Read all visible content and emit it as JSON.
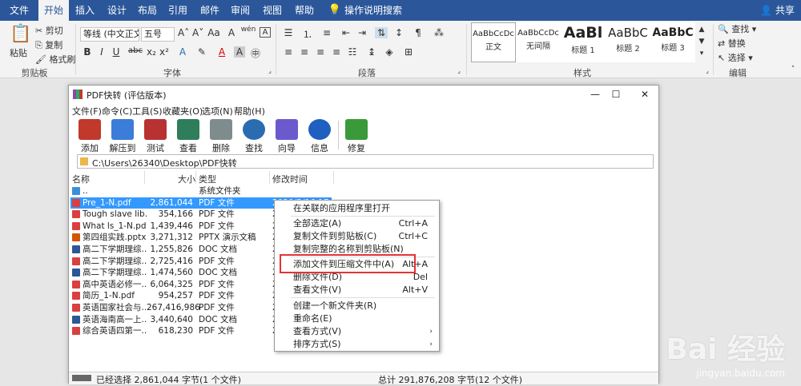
{
  "word": {
    "tabs": [
      "文件",
      "开始",
      "插入",
      "设计",
      "布局",
      "引用",
      "邮件",
      "审阅",
      "视图",
      "帮助"
    ],
    "search_hint": "操作说明搜索",
    "share": "共享",
    "clipboard": {
      "paste": "粘贴",
      "cut": "剪切",
      "copy": "复制",
      "format_painter": "格式刷",
      "label": "剪贴板"
    },
    "font": {
      "family": "等线 (中文正文)",
      "size": "五号",
      "label": "字体",
      "bold": "B",
      "italic": "I",
      "underline": "U",
      "wen": "wén"
    },
    "paragraph": {
      "label": "段落"
    },
    "styles": {
      "label": "样式",
      "items": [
        {
          "preview": "AaBbCcDc",
          "name": "正文"
        },
        {
          "preview": "AaBbCcDc",
          "name": "无间隔"
        },
        {
          "preview": "AaBl",
          "name": "标题 1"
        },
        {
          "preview": "AaBbC",
          "name": "标题 2"
        },
        {
          "preview": "AaBbC",
          "name": "标题 3"
        }
      ]
    },
    "editing": {
      "label": "编辑",
      "find": "查找",
      "replace": "替换",
      "select": "选择"
    }
  },
  "winrar": {
    "title": "PDF快转 (评估版本)",
    "menu": [
      "文件(F)",
      "命令(C)",
      "工具(S)",
      "收藏夹(O)",
      "选项(N)",
      "帮助(H)"
    ],
    "toolbar": [
      {
        "label": "添加",
        "color": "#c0392b"
      },
      {
        "label": "解压到",
        "color": "#3b7dd8"
      },
      {
        "label": "测试",
        "color": "#b83232"
      },
      {
        "label": "查看",
        "color": "#2e7d5b"
      },
      {
        "label": "删除",
        "color": "#7f8c8d"
      },
      {
        "label": "查找",
        "color": "#2b6cb0"
      },
      {
        "label": "向导",
        "color": "#6a5acd"
      },
      {
        "label": "信息",
        "color": "#1f5fbf"
      },
      {
        "label": "修复",
        "color": "#3a9a3a"
      }
    ],
    "address": "C:\\Users\\26340\\Desktop\\PDF快转",
    "columns": [
      "名称",
      "大小",
      "类型",
      "修改时间"
    ],
    "rows": [
      {
        "name": "..",
        "size": "",
        "type": "系统文件夹",
        "time": "",
        "icon": "#3b8fd8"
      },
      {
        "name": "Pre_1-N.pdf",
        "size": "2,861,044",
        "type": "PDF 文件",
        "time": "2020/3/16 17:...",
        "icon": "#d94040"
      },
      {
        "name": "Tough slave lib...",
        "size": "354,166",
        "type": "PDF 文件",
        "time": "2",
        "icon": "#d94040"
      },
      {
        "name": "What ls_1-N.pdf",
        "size": "1,439,446",
        "type": "PDF 文件",
        "time": "2",
        "icon": "#d94040"
      },
      {
        "name": "第四组实践.pptx",
        "size": "3,271,312",
        "type": "PPTX 演示文稿",
        "time": "2",
        "icon": "#d35400"
      },
      {
        "name": "高二下学期理综...",
        "size": "1,255,826",
        "type": "DOC 文档",
        "time": "2",
        "icon": "#2b5797"
      },
      {
        "name": "高二下学期理综...",
        "size": "2,725,416",
        "type": "PDF 文件",
        "time": "2",
        "icon": "#d94040"
      },
      {
        "name": "高二下学期理综...",
        "size": "1,474,560",
        "type": "DOC 文档",
        "time": "2",
        "icon": "#2b5797"
      },
      {
        "name": "高中英语必修一...",
        "size": "6,064,325",
        "type": "PDF 文件",
        "time": "2",
        "icon": "#d94040"
      },
      {
        "name": "简历_1-N.pdf",
        "size": "954,257",
        "type": "PDF 文件",
        "time": "2",
        "icon": "#d94040"
      },
      {
        "name": "英语国家社会与...",
        "size": "267,416,986",
        "type": "PDF 文件",
        "time": "2",
        "icon": "#d94040"
      },
      {
        "name": "英语海南高一上...",
        "size": "3,440,640",
        "type": "DOC 文档",
        "time": "2",
        "icon": "#2b5797"
      },
      {
        "name": "综合英语四第一...",
        "size": "618,230",
        "type": "PDF 文件",
        "time": "2",
        "icon": "#d94040"
      }
    ],
    "status_left": "已经选择 2,861,044 字节(1 个文件)",
    "status_right": "总计 291,876,208 字节(12 个文件)",
    "context_menu": [
      {
        "label": "在关联的应用程序里打开",
        "key": ""
      },
      {
        "label": "全部选定(A)",
        "key": "Ctrl+A"
      },
      {
        "label": "复制文件到剪贴板(C)",
        "key": "Ctrl+C"
      },
      {
        "label": "复制完整的名称到剪贴板(N)",
        "key": ""
      },
      {
        "label": "添加文件到压缩文件中(A)",
        "key": "Alt+A"
      },
      {
        "label": "删除文件(D)",
        "key": "Del"
      },
      {
        "label": "查看文件(V)",
        "key": "Alt+V"
      },
      {
        "label": "创建一个新文件夹(R)",
        "key": ""
      },
      {
        "label": "重命名(E)",
        "key": ""
      },
      {
        "label": "查看方式(V)",
        "key": ""
      },
      {
        "label": "排序方式(S)",
        "key": ""
      }
    ]
  },
  "watermark": {
    "logo": "Bai 经验",
    "url": "jingyan.baidu.com"
  }
}
